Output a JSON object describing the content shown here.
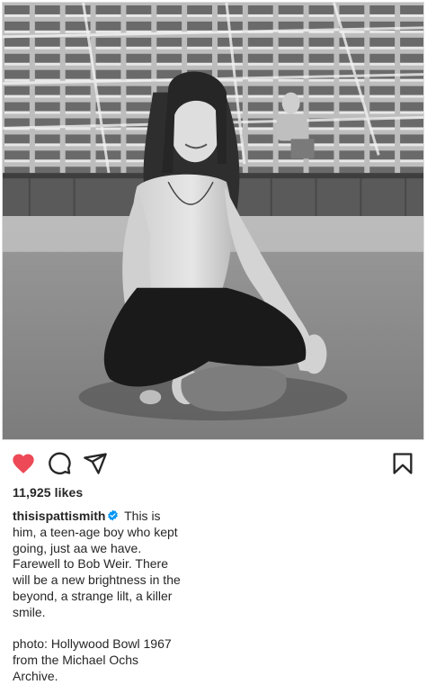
{
  "post": {
    "username": "thisispattismith",
    "verified": true,
    "likes": "11,925 likes",
    "caption": " This is him, a teen-age boy who kept going, just aa we have. Farewell to Bob Weir. There will be a new brightness in the beyond, a strange lilt, a killer smile.\n\nphoto: Hollywood Bowl 1967 from the Michael Ochs Archive.",
    "liked": true
  },
  "icons": {
    "like": "heart-filled-icon",
    "comment": "comment-bubble-icon",
    "share": "paper-plane-icon",
    "save": "bookmark-icon",
    "verified": "verified-badge-icon"
  },
  "colors": {
    "like": "#ed4956",
    "verified": "#0095f6",
    "text": "#262626"
  }
}
